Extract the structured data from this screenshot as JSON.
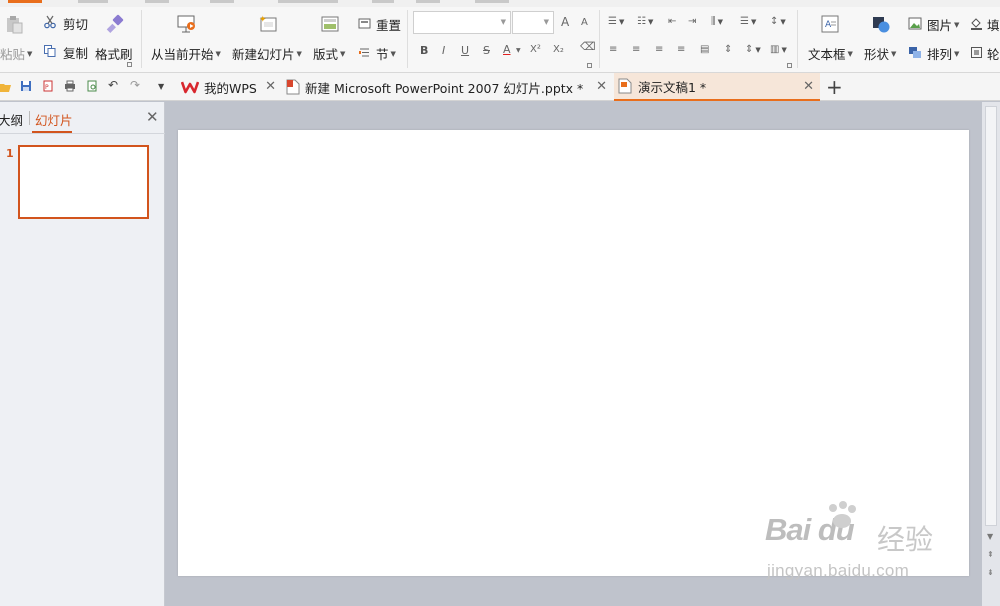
{
  "ribbon": {
    "paste": "粘贴",
    "cut": "剪切",
    "copy": "复制",
    "format_painter": "格式刷",
    "from_current": "从当前开始",
    "new_slide": "新建幻灯片",
    "layout": "版式",
    "reset": "重置",
    "section": "节",
    "font_name_placeholder": "",
    "font_size_placeholder": "",
    "grow_font": "A",
    "shrink_font": "A",
    "bold": "B",
    "italic": "I",
    "underline": "U",
    "strike": "S",
    "font_color": "A",
    "superscript": "X²",
    "subscript": "X₂",
    "textbox": "文本框",
    "shape": "形状",
    "picture": "图片",
    "arrange": "排列",
    "fill": "填",
    "outline": "轮"
  },
  "tabs": [
    {
      "label": "我的WPS"
    },
    {
      "label": "新建 Microsoft PowerPoint 2007 幻灯片.pptx *"
    },
    {
      "label": "演示文稿1 *"
    }
  ],
  "add_tab": "+",
  "left_panel": {
    "tab_outline": "大纲",
    "tab_slides": "幻灯片",
    "slide_number": "1"
  },
  "watermark": {
    "logo": "Bai du",
    "brand": "经验",
    "url": "jingyan.baidu.com"
  },
  "colors": {
    "accent": "#e96e1c",
    "wps_red": "#d8272e",
    "canvas_bg": "#bfc3cc"
  }
}
